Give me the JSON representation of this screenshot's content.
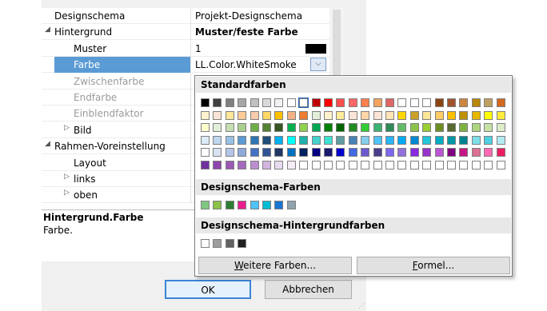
{
  "properties": [
    {
      "label": "Designschema",
      "value": "Projekt-Designschema",
      "indent": 16,
      "state": "normal",
      "expander": "",
      "value_bold": false
    },
    {
      "label": "Hintergrund",
      "value": "Muster/feste Farbe",
      "indent": 16,
      "state": "normal",
      "expander": "◢",
      "value_bold": true
    },
    {
      "label": "Muster",
      "value": "1",
      "indent": 40,
      "state": "normal",
      "expander": "",
      "value_bold": false,
      "swatch": "#000000"
    },
    {
      "label": "Farbe",
      "value": "LL.Color.WhiteSmoke",
      "indent": 40,
      "state": "selected",
      "expander": "",
      "value_bold": false,
      "dropdown": true
    },
    {
      "label": "Zwischenfarbe",
      "value": "",
      "indent": 40,
      "state": "disabled",
      "expander": "",
      "value_bold": false
    },
    {
      "label": "Endfarbe",
      "value": "",
      "indent": 40,
      "state": "disabled",
      "expander": "",
      "value_bold": false
    },
    {
      "label": "Einblendfaktor",
      "value": "",
      "indent": 40,
      "state": "disabled",
      "expander": "",
      "value_bold": false
    },
    {
      "label": "Bild",
      "value": "",
      "indent": 40,
      "state": "normal",
      "expander": "▷",
      "value_bold": false
    },
    {
      "label": "Rahmen-Voreinstellung",
      "value": "",
      "indent": 16,
      "state": "normal",
      "expander": "◢",
      "value_bold": false
    },
    {
      "label": "Layout",
      "value": "",
      "indent": 40,
      "state": "normal",
      "expander": "",
      "value_bold": false
    },
    {
      "label": "links",
      "value": "",
      "indent": 40,
      "state": "normal",
      "expander": "▷",
      "value_bold": false
    },
    {
      "label": "oben",
      "value": "",
      "indent": 40,
      "state": "normal",
      "expander": "▷",
      "value_bold": false
    }
  ],
  "description": {
    "title": "Hintergrund.Farbe",
    "body": "Farbe."
  },
  "buttons": {
    "ok": "OK",
    "cancel": "Abbrechen"
  },
  "popup": {
    "standard_title": "Standardfarben",
    "schema_title": "Designschema-Farben",
    "schema_bg_title": "Designschema-Hintergrundfarben",
    "more_colors": "Weitere Farben...",
    "formula": "Formel...",
    "standard_colors": [
      [
        "#000000",
        "#404040",
        "#808080",
        "#a6a6a6",
        "#c0c0c0",
        "#d9d9d9",
        "#f2f2f2",
        "#ffffff",
        "#ffffff",
        "#c00000",
        "#ff0000",
        "#ff5050",
        "#ff6666",
        "#ff7f50",
        "#f4a460",
        "#e06666",
        "#ffffff",
        "#ffffff",
        "#ffffff",
        "#8b4513",
        "#a0522d",
        "#cd853f",
        "#b8860b",
        "#c0a060",
        "#d2691e"
      ],
      [
        "#fff2cc",
        "#fce4d6",
        "#ffe699",
        "#ffcc99",
        "#f8cbad",
        "#ffd966",
        "#ffc000",
        "#f4b183",
        "#ed7d31",
        "#e2efda",
        "#fff2cc",
        "#ffeb9c",
        "#fbe5d6",
        "#ffd7a8",
        "#fce4d6",
        "#ffe4b5",
        "#ffd700",
        "#c9a227",
        "#ffe699",
        "#ffcc66",
        "#ffc000",
        "#bf9000",
        "#e6b800",
        "#ffff00",
        "#ffeb3b"
      ],
      [
        "#ffffcc",
        "#e2efda",
        "#c6e0b4",
        "#a9d08e",
        "#70ad47",
        "#548235",
        "#375623",
        "#00b050",
        "#92d050",
        "#00a651",
        "#008000",
        "#006400",
        "#228b22",
        "#32cd32",
        "#3cb371",
        "#2e8b57",
        "#66bb6a",
        "#8bc34a",
        "#9acd32",
        "#6b8e23",
        "#556b2f",
        "#7cb342",
        "#aed581",
        "#c5e1a5",
        "#dcedc8"
      ],
      [
        "#ddebf7",
        "#bdd7ee",
        "#9bc2e6",
        "#5b9bd5",
        "#2f75b5",
        "#1f4e78",
        "#00b0f0",
        "#00ffff",
        "#20b2aa",
        "#48d1cc",
        "#40e0d0",
        "#5f9ea0",
        "#4682b4",
        "#87ceeb",
        "#4fc3f7",
        "#29b6f6",
        "#03a9f4",
        "#0288d1",
        "#26c6da",
        "#00acc1",
        "#0097a7",
        "#00838f",
        "#80deea",
        "#4dd0e1",
        "#b2ebf2"
      ],
      [
        "#ffffff",
        "#d9e1f2",
        "#b4c6e7",
        "#8ea9db",
        "#4472c4",
        "#305496",
        "#203764",
        "#0070c0",
        "#002060",
        "#000080",
        "#191970",
        "#0000cd",
        "#4169e1",
        "#6a5acd",
        "#483d8b",
        "#7b68ee",
        "#9370db",
        "#8a2be2",
        "#9932cc",
        "#ba55d3",
        "#800080",
        "#c71585",
        "#db7093",
        "#ff69b4",
        "#e91e63"
      ],
      [
        "#7030a0",
        "#8e44ad",
        "#9b59b6",
        "#a569bd",
        "#bb8fce",
        "#d2b4de",
        "#e8daef",
        "#f5eef8",
        "#ffffff",
        "#ffffff",
        "#ffffff",
        "#ffffff",
        "#ffffff",
        "#ffffff",
        "#ffffff",
        "#ffffff",
        "#ffffff",
        "#ffffff",
        "#ffffff",
        "#ffffff",
        "#ffffff",
        "#ffffff",
        "#ffffff",
        "#ffffff",
        "#ffffff"
      ]
    ],
    "schema_colors": [
      "#81c784",
      "#8bc34a",
      "#2e7d32",
      "#e91e8c",
      "#4fc3f7",
      "#00bcd4",
      "#1976d2",
      "#90a4ae"
    ],
    "schema_bg_colors": [
      "#ffffff",
      "#9e9e9e",
      "#616161",
      "#212121"
    ]
  }
}
